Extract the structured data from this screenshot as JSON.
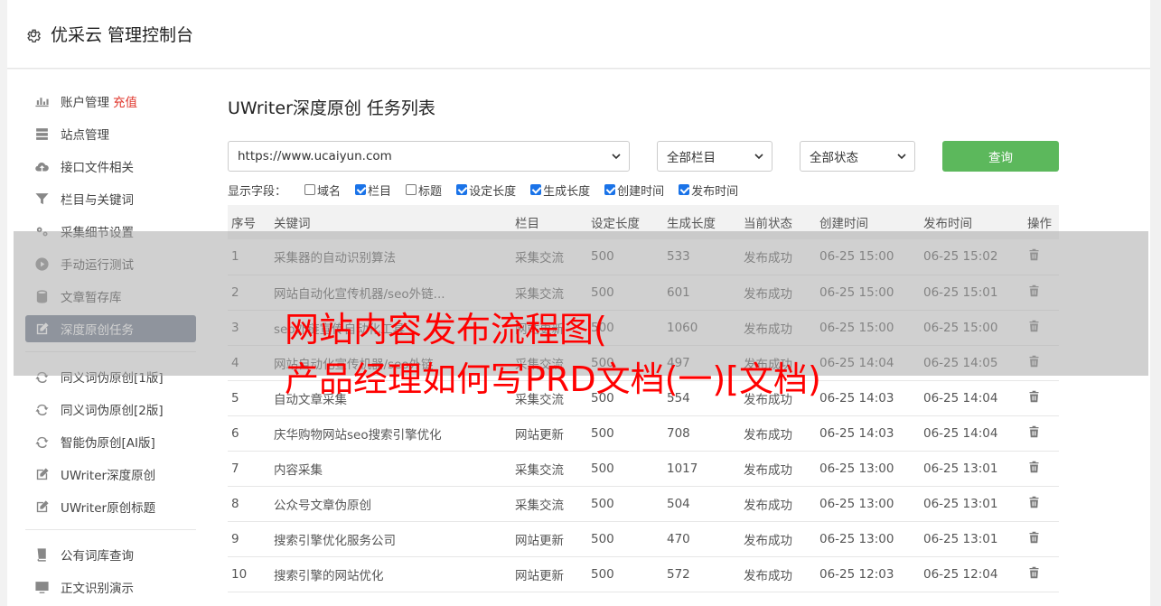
{
  "header": {
    "title": "优采云 管理控制台"
  },
  "sidebar": {
    "items": [
      {
        "label": "账户管理",
        "badge": "充值",
        "icon": "bar-chart-icon"
      },
      {
        "label": "站点管理",
        "icon": "server-icon"
      },
      {
        "label": "接口文件相关",
        "icon": "cloud-upload-icon"
      },
      {
        "label": "栏目与关键词",
        "icon": "filter-icon"
      },
      {
        "label": "采集细节设置",
        "icon": "gears-icon"
      },
      {
        "label": "手动运行测试",
        "icon": "play-circle-icon"
      },
      {
        "label": "文章暂存库",
        "icon": "database-icon"
      },
      {
        "label": "深度原创任务",
        "icon": "edit-icon",
        "active": true
      },
      {
        "label": "同义词伪原创[1版]",
        "icon": "refresh-icon"
      },
      {
        "label": "同义词伪原创[2版]",
        "icon": "refresh-icon"
      },
      {
        "label": "智能伪原创[AI版]",
        "icon": "refresh-icon"
      },
      {
        "label": "UWriter深度原创",
        "icon": "edit-icon"
      },
      {
        "label": "UWriter原创标题",
        "icon": "edit-icon"
      },
      {
        "label": "公有词库查询",
        "icon": "book-icon"
      },
      {
        "label": "正文识别演示",
        "icon": "monitor-icon"
      }
    ]
  },
  "main": {
    "title": "UWriter深度原创 任务列表",
    "site_select": "https://www.ucaiyun.com",
    "column_select": "全部栏目",
    "status_select": "全部状态",
    "query_label": "查询",
    "fields_label": "显示字段：",
    "fields": [
      {
        "label": "域名",
        "checked": false
      },
      {
        "label": "栏目",
        "checked": true
      },
      {
        "label": "标题",
        "checked": false
      },
      {
        "label": "设定长度",
        "checked": true
      },
      {
        "label": "生成长度",
        "checked": true
      },
      {
        "label": "创建时间",
        "checked": true
      },
      {
        "label": "发布时间",
        "checked": true
      }
    ],
    "table": {
      "headers": [
        "序号",
        "关键词",
        "栏目",
        "设定长度",
        "生成长度",
        "当前状态",
        "创建时间",
        "发布时间",
        "操作"
      ],
      "rows": [
        [
          "1",
          "采集器的自动识别算法",
          "采集交流",
          "500",
          "533",
          "发布成功",
          "06-25 15:00",
          "06-25 15:02"
        ],
        [
          "2",
          "网站自动化宣传机器/seo外链...",
          "采集交流",
          "500",
          "601",
          "发布成功",
          "06-25 15:00",
          "06-25 15:01"
        ],
        [
          "3",
          "seo外链宣传自动化工具",
          "网站更新",
          "500",
          "1060",
          "发布成功",
          "06-25 15:00",
          "06-25 15:00"
        ],
        [
          "4",
          "网站自动化宣传机器/seo外链",
          "采集交流",
          "500",
          "497",
          "发布成功",
          "06-25 14:04",
          "06-25 14:05"
        ],
        [
          "5",
          "自动文章采集",
          "采集交流",
          "500",
          "554",
          "发布成功",
          "06-25 14:03",
          "06-25 14:04"
        ],
        [
          "6",
          "庆华购物网站seo搜索引擎优化",
          "网站更新",
          "500",
          "708",
          "发布成功",
          "06-25 14:03",
          "06-25 14:04"
        ],
        [
          "7",
          "内容采集",
          "采集交流",
          "500",
          "1017",
          "发布成功",
          "06-25 13:00",
          "06-25 13:01"
        ],
        [
          "8",
          "公众号文章伪原创",
          "采集交流",
          "500",
          "504",
          "发布成功",
          "06-25 13:00",
          "06-25 13:01"
        ],
        [
          "9",
          "搜索引擎优化服务公司",
          "网站更新",
          "500",
          "470",
          "发布成功",
          "06-25 13:00",
          "06-25 13:01"
        ],
        [
          "10",
          "搜索引擎的网站优化",
          "网站更新",
          "500",
          "572",
          "发布成功",
          "06-25 12:03",
          "06-25 12:04"
        ]
      ]
    }
  },
  "overlay": {
    "line1": "网站内容发布流程图(",
    "line2": "产品经理如何写PRD文档(一)[文档)"
  }
}
